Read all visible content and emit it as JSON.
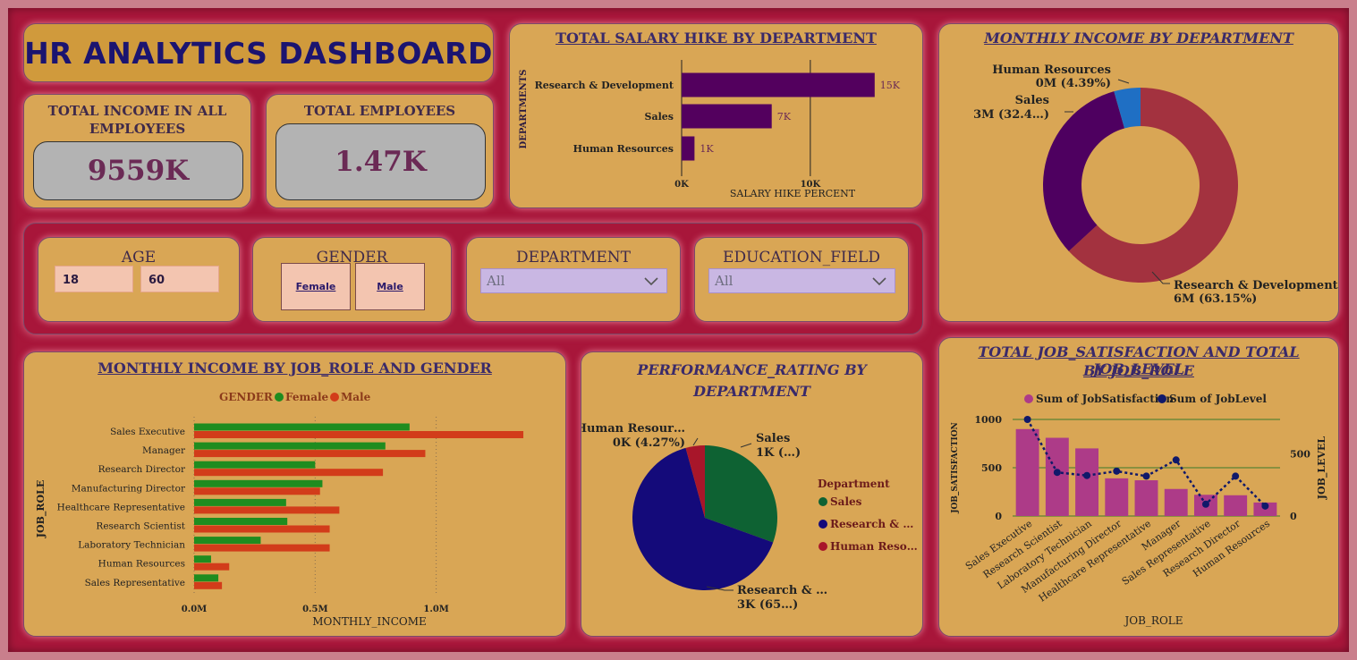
{
  "dashboard_title": "HR ANALYTICS DASHBOARD",
  "kpis": {
    "income_label": "TOTAL INCOME IN ALL EMPLOYEES",
    "income_value": "9559K",
    "employees_label": "TOTAL EMPLOYEES",
    "employees_value": "1.47K"
  },
  "filters": {
    "age": {
      "label": "AGE",
      "min": "18",
      "max": "60"
    },
    "gender": {
      "label": "GENDER",
      "options": [
        "Female",
        "Male"
      ]
    },
    "department": {
      "label": "DEPARTMENT",
      "selected": "All"
    },
    "education_field": {
      "label": "EDUCATION_FIELD",
      "selected": "All"
    }
  },
  "colors": {
    "purple_bar": "#53005e",
    "female": "#1f8c1f",
    "male": "#d23c1a",
    "donut_rd": "#a3323f",
    "donut_sales": "#4e0060",
    "donut_hr": "#1f6fc4",
    "pie_sales": "#0e6233",
    "pie_rd": "#140a7a",
    "pie_hr": "#a8162a",
    "js_bar": "#ad3b88",
    "jl_line": "#10196a"
  },
  "chart_data": [
    {
      "id": "salary_hike",
      "type": "bar",
      "orientation": "horizontal",
      "title": "TOTAL SALARY HIKE BY DEPARTMENT",
      "xlabel": "SALARY HIKE PERCENT",
      "ylabel": "DEPARTMENTS",
      "categories": [
        "Research & Development",
        "Sales",
        "Human Resources"
      ],
      "values": [
        15000,
        7000,
        1000
      ],
      "data_labels": [
        "15K",
        "7K",
        "1K"
      ],
      "xticks": [
        "0K",
        "10K"
      ],
      "xlim": [
        0,
        15500
      ]
    },
    {
      "id": "income_by_department",
      "type": "pie",
      "style": "donut",
      "title": "MONTHLY INCOME BY DEPARTMENT",
      "slices": [
        {
          "name": "Research & Development",
          "percent": 63.15,
          "label_line1": "Research & Development",
          "label_line2": "6M (63.15%)"
        },
        {
          "name": "Sales",
          "percent": 32.46,
          "label_line1": "Sales",
          "label_line2": "3M (32.4…)"
        },
        {
          "name": "Human Resources",
          "percent": 4.39,
          "label_line1": "Human Resources",
          "label_line2": "0M (4.39%)"
        }
      ]
    },
    {
      "id": "income_by_jobrole_gender",
      "type": "bar",
      "orientation": "horizontal",
      "title": "MONTHLY INCOME BY JOB_ROLE AND GENDER",
      "xlabel": "MONTHLY_INCOME",
      "ylabel": "JOB_ROLE",
      "legend_title": "GENDER",
      "categories": [
        "Sales Executive",
        "Manager",
        "Research Director",
        "Manufacturing Director",
        "Healthcare Representative",
        "Research Scientist",
        "Laboratory Technician",
        "Human Resources",
        "Sales Representative"
      ],
      "series": [
        {
          "name": "Female",
          "values": [
            890000,
            790000,
            500000,
            530000,
            380000,
            385000,
            275000,
            70000,
            100000
          ]
        },
        {
          "name": "Male",
          "values": [
            1360000,
            955000,
            780000,
            520000,
            600000,
            560000,
            560000,
            145000,
            115000
          ]
        }
      ],
      "xticks": [
        "0.0M",
        "0.5M",
        "1.0M"
      ],
      "xlim": [
        0,
        1430000
      ]
    },
    {
      "id": "performance_by_department",
      "type": "pie",
      "title": "PERFORMANCE_RATING BY DEPARTMENT",
      "legend_title": "Department",
      "legend": [
        "Sales",
        "Research & …",
        "Human Reso…"
      ],
      "slices": [
        {
          "name": "Sales",
          "percent": 30.5,
          "label_line1": "Sales",
          "label_line2": "1K (…)"
        },
        {
          "name": "Research & Development",
          "percent": 65.23,
          "label_line1": "Research & …",
          "label_line2": "3K (65…)"
        },
        {
          "name": "Human Resources",
          "percent": 4.27,
          "label_line1": "Human Resour…",
          "label_line2": "0K (4.27%)"
        }
      ]
    },
    {
      "id": "satisfaction_level_by_jobrole",
      "type": "bar",
      "title_line1": "TOTAL JOB_SATISFACTION AND TOTAL JOB_LEVEL",
      "title_line2": "BY JOB_ROLE",
      "xlabel": "JOB_ROLE",
      "ylabel_left": "JOB_SATISFACTION",
      "ylabel_right": "JOB_LEVEL",
      "categories": [
        "Sales Executive",
        "Research Scientist",
        "Laboratory Technician",
        "Manufacturing Director",
        "Healthcare Representative",
        "Manager",
        "Sales Representative",
        "Research Director",
        "Human Resources"
      ],
      "series": [
        {
          "name": "Sum of JobSatisfaction",
          "kind": "bar",
          "values": [
            900,
            810,
            700,
            390,
            370,
            280,
            220,
            215,
            140
          ]
        },
        {
          "name": "Sum of JobLevel",
          "kind": "line",
          "values": [
            775,
            350,
            325,
            360,
            320,
            450,
            95,
            320,
            80
          ]
        }
      ],
      "yticks_left": [
        "1000",
        "500",
        "0"
      ],
      "ylim_left": [
        0,
        1000
      ],
      "yticks_right": [
        "500",
        "0"
      ],
      "ylim_right": [
        0,
        775
      ]
    }
  ]
}
